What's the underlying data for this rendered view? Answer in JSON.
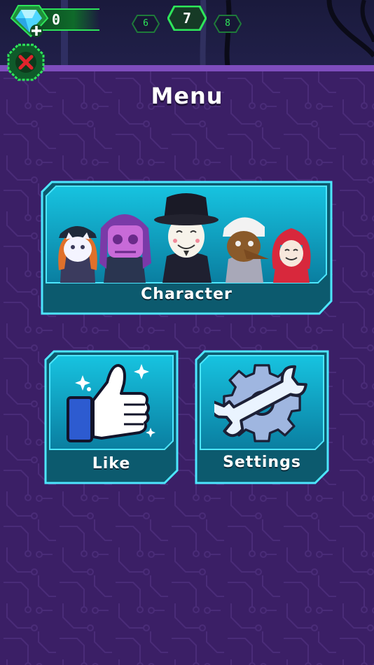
{
  "hud": {
    "gem_count": "0",
    "levels": {
      "previous": "6",
      "current": "7",
      "next": "8"
    }
  },
  "menu": {
    "title": "Menu",
    "cards": {
      "character": "Character",
      "like": "Like",
      "settings": "Settings"
    }
  },
  "colors": {
    "background": "#3b1f66",
    "accent_green": "#2ee65a",
    "card_teal": "#0f9fbe",
    "card_border": "#4de6ff",
    "close_red": "#e0242c"
  },
  "icons": [
    "gem-icon",
    "plus-icon",
    "close-icon",
    "thumbs-up-icon",
    "wrench-gear-icon"
  ]
}
